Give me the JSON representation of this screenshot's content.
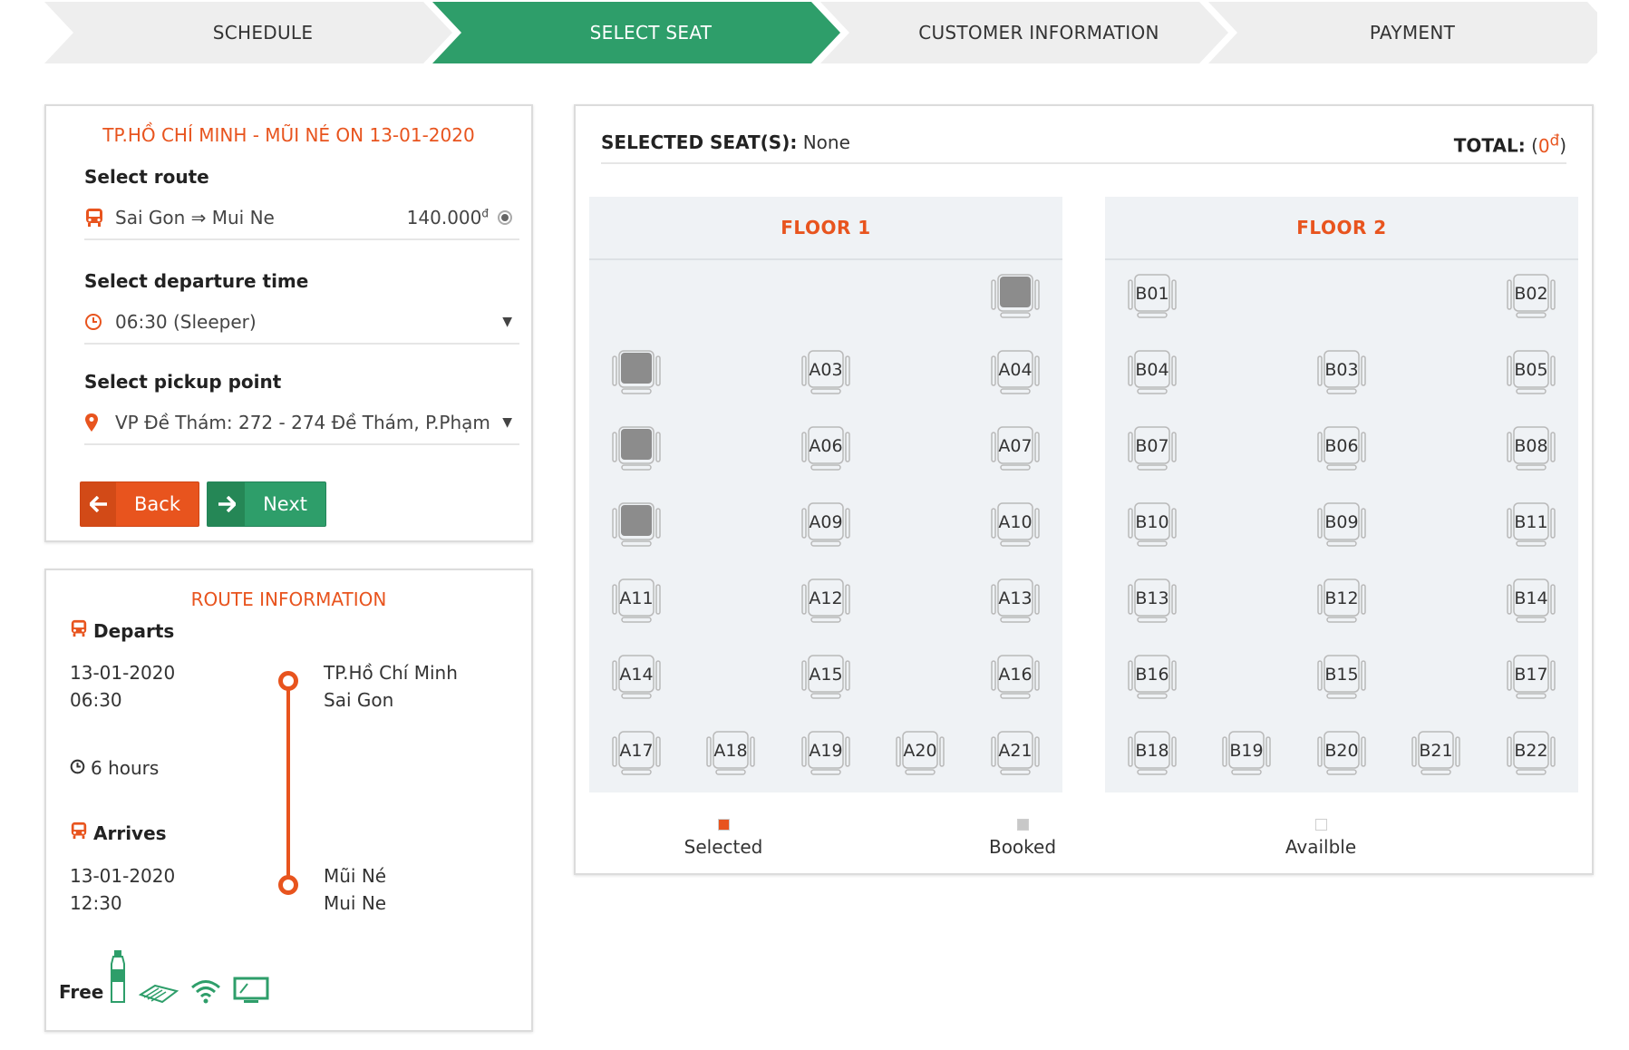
{
  "steps": [
    {
      "label": "SCHEDULE",
      "active": false
    },
    {
      "label": "SELECT SEAT",
      "active": true
    },
    {
      "label": "CUSTOMER INFORMATION",
      "active": false
    },
    {
      "label": "PAYMENT",
      "active": false
    }
  ],
  "booking": {
    "trip_title": "TP.HỒ CHÍ MINH - MŨI NÉ ON 13-01-2020",
    "route_label": "Select route",
    "route_value": "Sai Gon ⇒ Mui Ne",
    "route_price": "140.000",
    "currency": "đ",
    "departure_label": "Select departure time",
    "departure_value": "06:30 (Sleeper)",
    "pickup_label": "Select pickup point",
    "pickup_value": "VP Đề Thám: 272 - 274 Đề Thám, P.Phạm",
    "back_label": "Back",
    "next_label": "Next"
  },
  "route_info": {
    "title": "ROUTE INFORMATION",
    "departs_label": "Departs",
    "departs_date": "13-01-2020",
    "departs_time": "06:30",
    "departs_city": "TP.Hồ Chí Minh",
    "departs_place": "Sai Gon",
    "duration": "6 hours",
    "arrives_label": "Arrives",
    "arrives_date": "13-01-2020",
    "arrives_time": "12:30",
    "arrives_city": "Mũi Né",
    "arrives_place": "Mui Ne",
    "free_label": "Free",
    "amenities": [
      "water-bottle-icon",
      "towel-icon",
      "wifi-icon",
      "tv-icon"
    ]
  },
  "seat_map": {
    "selected_label": "SELECTED SEAT(S):",
    "selected_value": "None",
    "total_label": "TOTAL:",
    "total_open": "(",
    "total_amount": "0",
    "total_currency": "đ",
    "total_close": ")",
    "floors": [
      {
        "title": "FLOOR 1",
        "rows": [
          [
            null,
            null,
            null,
            null,
            {
              "id": "",
              "status": "booked"
            }
          ],
          [
            {
              "id": "",
              "status": "booked"
            },
            null,
            {
              "id": "A03",
              "status": "available"
            },
            null,
            {
              "id": "A04",
              "status": "available"
            }
          ],
          [
            {
              "id": "",
              "status": "booked"
            },
            null,
            {
              "id": "A06",
              "status": "available"
            },
            null,
            {
              "id": "A07",
              "status": "available"
            }
          ],
          [
            {
              "id": "",
              "status": "booked"
            },
            null,
            {
              "id": "A09",
              "status": "available"
            },
            null,
            {
              "id": "A10",
              "status": "available"
            }
          ],
          [
            {
              "id": "A11",
              "status": "available"
            },
            null,
            {
              "id": "A12",
              "status": "available"
            },
            null,
            {
              "id": "A13",
              "status": "available"
            }
          ],
          [
            {
              "id": "A14",
              "status": "available"
            },
            null,
            {
              "id": "A15",
              "status": "available"
            },
            null,
            {
              "id": "A16",
              "status": "available"
            }
          ],
          [
            {
              "id": "A17",
              "status": "available"
            },
            {
              "id": "A18",
              "status": "available"
            },
            {
              "id": "A19",
              "status": "available"
            },
            {
              "id": "A20",
              "status": "available"
            },
            {
              "id": "A21",
              "status": "available"
            }
          ]
        ]
      },
      {
        "title": "FLOOR 2",
        "rows": [
          [
            {
              "id": "B01",
              "status": "available"
            },
            null,
            null,
            null,
            {
              "id": "B02",
              "status": "available"
            }
          ],
          [
            {
              "id": "B04",
              "status": "available"
            },
            null,
            {
              "id": "B03",
              "status": "available"
            },
            null,
            {
              "id": "B05",
              "status": "available"
            }
          ],
          [
            {
              "id": "B07",
              "status": "available"
            },
            null,
            {
              "id": "B06",
              "status": "available"
            },
            null,
            {
              "id": "B08",
              "status": "available"
            }
          ],
          [
            {
              "id": "B10",
              "status": "available"
            },
            null,
            {
              "id": "B09",
              "status": "available"
            },
            null,
            {
              "id": "B11",
              "status": "available"
            }
          ],
          [
            {
              "id": "B13",
              "status": "available"
            },
            null,
            {
              "id": "B12",
              "status": "available"
            },
            null,
            {
              "id": "B14",
              "status": "available"
            }
          ],
          [
            {
              "id": "B16",
              "status": "available"
            },
            null,
            {
              "id": "B15",
              "status": "available"
            },
            null,
            {
              "id": "B17",
              "status": "available"
            }
          ],
          [
            {
              "id": "B18",
              "status": "available"
            },
            {
              "id": "B19",
              "status": "available"
            },
            {
              "id": "B20",
              "status": "available"
            },
            {
              "id": "B21",
              "status": "available"
            },
            {
              "id": "B22",
              "status": "available"
            }
          ]
        ]
      }
    ],
    "legend": [
      {
        "label": "Selected",
        "color": "#e8541e"
      },
      {
        "label": "Booked",
        "color": "#c8c8c8"
      },
      {
        "label": "Availble",
        "color": "#ffffff"
      }
    ]
  },
  "colors": {
    "accent": "#e8541e",
    "brand": "#2e9e6a"
  }
}
